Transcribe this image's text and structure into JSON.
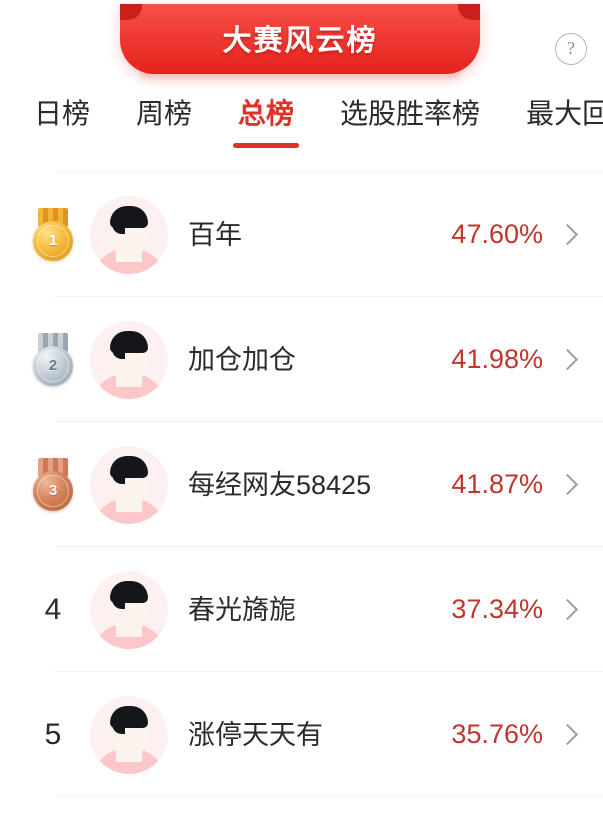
{
  "banner": {
    "title": "大赛风云榜",
    "color": "#e5231d"
  },
  "help": {
    "icon": "question-mark-icon",
    "label": "?"
  },
  "tabs": [
    {
      "label": "日榜",
      "active": false
    },
    {
      "label": "周榜",
      "active": false
    },
    {
      "label": "总榜",
      "active": true
    },
    {
      "label": "选股胜率榜",
      "active": false
    },
    {
      "label": "最大回撤",
      "active": false
    }
  ],
  "colors": {
    "accent": "#e03127",
    "percent": "#c0352c",
    "text": "#2b2b2b",
    "divider": "#f1f2f4"
  },
  "ranking": [
    {
      "rank": "1",
      "medal": "gold",
      "name": "百年",
      "percent": "47.60%"
    },
    {
      "rank": "2",
      "medal": "silver",
      "name": "加仓加仓",
      "percent": "41.98%"
    },
    {
      "rank": "3",
      "medal": "bronze",
      "name": "每经网友58425",
      "percent": "41.87%"
    },
    {
      "rank": "4",
      "medal": "none",
      "name": "春光旖旎",
      "percent": "37.34%"
    },
    {
      "rank": "5",
      "medal": "none",
      "name": "涨停天天有",
      "percent": "35.76%"
    }
  ]
}
